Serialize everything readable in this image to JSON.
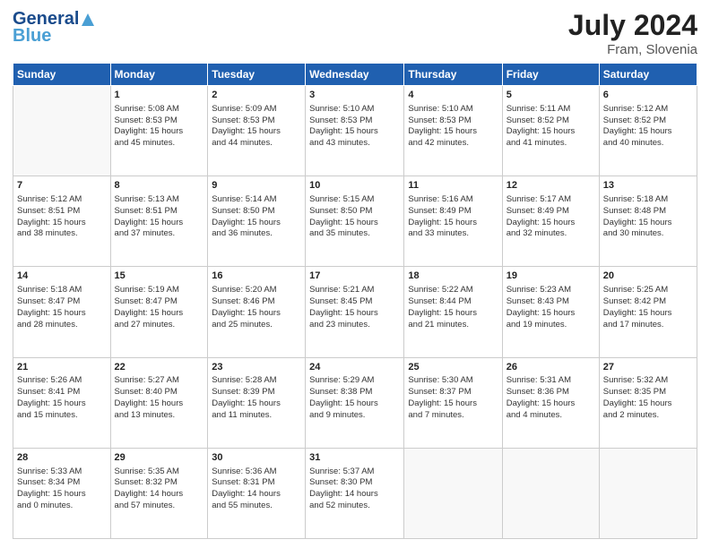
{
  "header": {
    "logo_general": "General",
    "logo_blue": "Blue",
    "title": "July 2024",
    "subtitle": "Fram, Slovenia"
  },
  "days_of_week": [
    "Sunday",
    "Monday",
    "Tuesday",
    "Wednesday",
    "Thursday",
    "Friday",
    "Saturday"
  ],
  "weeks": [
    [
      {
        "day": "",
        "info": ""
      },
      {
        "day": "1",
        "info": "Sunrise: 5:08 AM\nSunset: 8:53 PM\nDaylight: 15 hours\nand 45 minutes."
      },
      {
        "day": "2",
        "info": "Sunrise: 5:09 AM\nSunset: 8:53 PM\nDaylight: 15 hours\nand 44 minutes."
      },
      {
        "day": "3",
        "info": "Sunrise: 5:10 AM\nSunset: 8:53 PM\nDaylight: 15 hours\nand 43 minutes."
      },
      {
        "day": "4",
        "info": "Sunrise: 5:10 AM\nSunset: 8:53 PM\nDaylight: 15 hours\nand 42 minutes."
      },
      {
        "day": "5",
        "info": "Sunrise: 5:11 AM\nSunset: 8:52 PM\nDaylight: 15 hours\nand 41 minutes."
      },
      {
        "day": "6",
        "info": "Sunrise: 5:12 AM\nSunset: 8:52 PM\nDaylight: 15 hours\nand 40 minutes."
      }
    ],
    [
      {
        "day": "7",
        "info": "Sunrise: 5:12 AM\nSunset: 8:51 PM\nDaylight: 15 hours\nand 38 minutes."
      },
      {
        "day": "8",
        "info": "Sunrise: 5:13 AM\nSunset: 8:51 PM\nDaylight: 15 hours\nand 37 minutes."
      },
      {
        "day": "9",
        "info": "Sunrise: 5:14 AM\nSunset: 8:50 PM\nDaylight: 15 hours\nand 36 minutes."
      },
      {
        "day": "10",
        "info": "Sunrise: 5:15 AM\nSunset: 8:50 PM\nDaylight: 15 hours\nand 35 minutes."
      },
      {
        "day": "11",
        "info": "Sunrise: 5:16 AM\nSunset: 8:49 PM\nDaylight: 15 hours\nand 33 minutes."
      },
      {
        "day": "12",
        "info": "Sunrise: 5:17 AM\nSunset: 8:49 PM\nDaylight: 15 hours\nand 32 minutes."
      },
      {
        "day": "13",
        "info": "Sunrise: 5:18 AM\nSunset: 8:48 PM\nDaylight: 15 hours\nand 30 minutes."
      }
    ],
    [
      {
        "day": "14",
        "info": "Sunrise: 5:18 AM\nSunset: 8:47 PM\nDaylight: 15 hours\nand 28 minutes."
      },
      {
        "day": "15",
        "info": "Sunrise: 5:19 AM\nSunset: 8:47 PM\nDaylight: 15 hours\nand 27 minutes."
      },
      {
        "day": "16",
        "info": "Sunrise: 5:20 AM\nSunset: 8:46 PM\nDaylight: 15 hours\nand 25 minutes."
      },
      {
        "day": "17",
        "info": "Sunrise: 5:21 AM\nSunset: 8:45 PM\nDaylight: 15 hours\nand 23 minutes."
      },
      {
        "day": "18",
        "info": "Sunrise: 5:22 AM\nSunset: 8:44 PM\nDaylight: 15 hours\nand 21 minutes."
      },
      {
        "day": "19",
        "info": "Sunrise: 5:23 AM\nSunset: 8:43 PM\nDaylight: 15 hours\nand 19 minutes."
      },
      {
        "day": "20",
        "info": "Sunrise: 5:25 AM\nSunset: 8:42 PM\nDaylight: 15 hours\nand 17 minutes."
      }
    ],
    [
      {
        "day": "21",
        "info": "Sunrise: 5:26 AM\nSunset: 8:41 PM\nDaylight: 15 hours\nand 15 minutes."
      },
      {
        "day": "22",
        "info": "Sunrise: 5:27 AM\nSunset: 8:40 PM\nDaylight: 15 hours\nand 13 minutes."
      },
      {
        "day": "23",
        "info": "Sunrise: 5:28 AM\nSunset: 8:39 PM\nDaylight: 15 hours\nand 11 minutes."
      },
      {
        "day": "24",
        "info": "Sunrise: 5:29 AM\nSunset: 8:38 PM\nDaylight: 15 hours\nand 9 minutes."
      },
      {
        "day": "25",
        "info": "Sunrise: 5:30 AM\nSunset: 8:37 PM\nDaylight: 15 hours\nand 7 minutes."
      },
      {
        "day": "26",
        "info": "Sunrise: 5:31 AM\nSunset: 8:36 PM\nDaylight: 15 hours\nand 4 minutes."
      },
      {
        "day": "27",
        "info": "Sunrise: 5:32 AM\nSunset: 8:35 PM\nDaylight: 15 hours\nand 2 minutes."
      }
    ],
    [
      {
        "day": "28",
        "info": "Sunrise: 5:33 AM\nSunset: 8:34 PM\nDaylight: 15 hours\nand 0 minutes."
      },
      {
        "day": "29",
        "info": "Sunrise: 5:35 AM\nSunset: 8:32 PM\nDaylight: 14 hours\nand 57 minutes."
      },
      {
        "day": "30",
        "info": "Sunrise: 5:36 AM\nSunset: 8:31 PM\nDaylight: 14 hours\nand 55 minutes."
      },
      {
        "day": "31",
        "info": "Sunrise: 5:37 AM\nSunset: 8:30 PM\nDaylight: 14 hours\nand 52 minutes."
      },
      {
        "day": "",
        "info": ""
      },
      {
        "day": "",
        "info": ""
      },
      {
        "day": "",
        "info": ""
      }
    ]
  ]
}
